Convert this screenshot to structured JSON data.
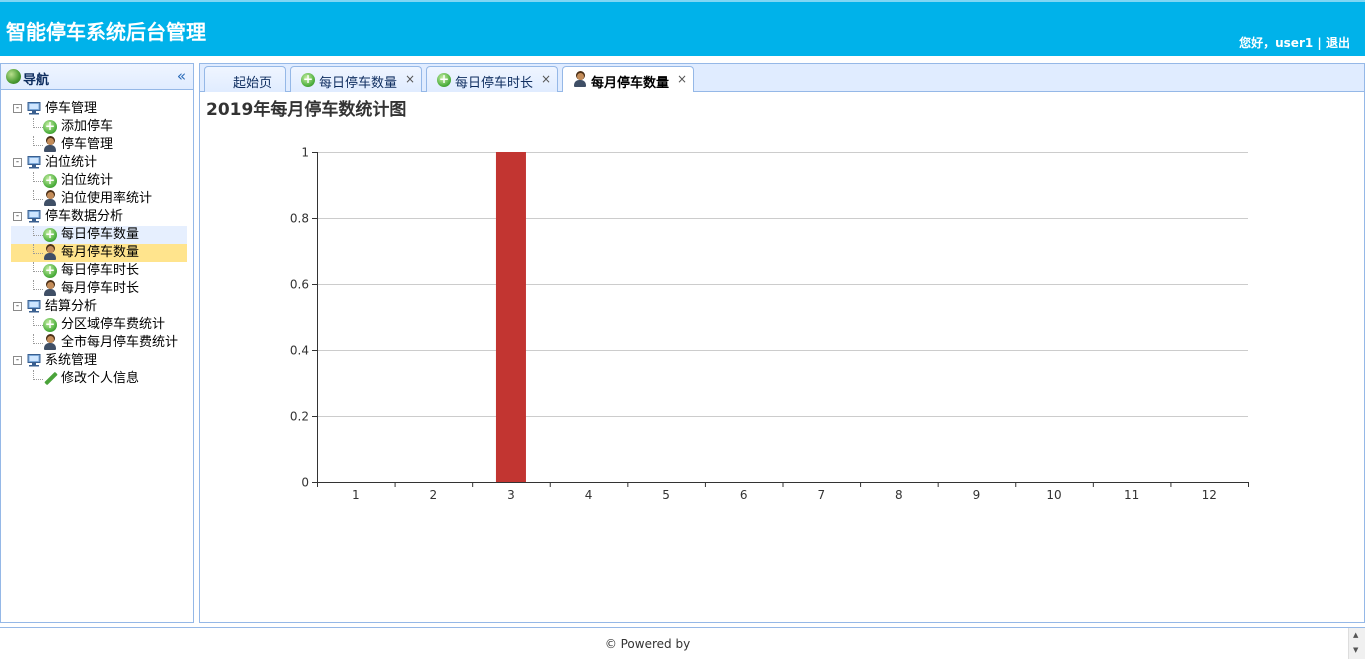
{
  "app": {
    "title": "智能停车系统后台管理",
    "greeting": "您好，user1",
    "separator": "|",
    "logout": "退出"
  },
  "nav": {
    "title": "导航",
    "collapse_icon": "double-chevron-left-icon",
    "groups": [
      {
        "label": "停车管理",
        "expander": "-",
        "items": [
          {
            "label": "添加停车",
            "icon": "add-icon"
          },
          {
            "label": "停车管理",
            "icon": "user-icon"
          }
        ]
      },
      {
        "label": "泊位统计",
        "expander": "-",
        "items": [
          {
            "label": "泊位统计",
            "icon": "add-icon"
          },
          {
            "label": "泊位使用率统计",
            "icon": "user-icon"
          }
        ]
      },
      {
        "label": "停车数据分析",
        "expander": "-",
        "items": [
          {
            "label": "每日停车数量",
            "icon": "add-icon"
          },
          {
            "label": "每月停车数量",
            "icon": "user-icon"
          },
          {
            "label": "每日停车时长",
            "icon": "add-icon"
          },
          {
            "label": "每月停车时长",
            "icon": "user-icon"
          }
        ]
      },
      {
        "label": "结算分析",
        "expander": "-",
        "items": [
          {
            "label": "分区域停车费统计",
            "icon": "add-icon"
          },
          {
            "label": "全市每月停车费统计",
            "icon": "user-icon"
          }
        ]
      },
      {
        "label": "系统管理",
        "expander": "-",
        "items": [
          {
            "label": "修改个人信息",
            "icon": "pencil-icon"
          }
        ]
      }
    ]
  },
  "tabs": [
    {
      "label": "起始页",
      "icon": "",
      "closable": false,
      "active": false
    },
    {
      "label": "每日停车数量",
      "icon": "add-icon",
      "close": "×",
      "active": false
    },
    {
      "label": "每日停车时长",
      "icon": "add-icon",
      "close": "×",
      "active": false
    },
    {
      "label": "每月停车数量",
      "icon": "user-icon",
      "close": "×",
      "active": true
    }
  ],
  "chart_data": {
    "type": "bar",
    "title": "2019年每月停车数统计图",
    "categories": [
      "1",
      "2",
      "3",
      "4",
      "5",
      "6",
      "7",
      "8",
      "9",
      "10",
      "11",
      "12"
    ],
    "values": [
      0,
      0,
      1,
      0,
      0,
      0,
      0,
      0,
      0,
      0,
      0,
      0
    ],
    "yticks": [
      "0",
      "0.2",
      "0.4",
      "0.6",
      "0.8",
      "1"
    ],
    "ylim": [
      0,
      1
    ],
    "grid": true,
    "bar_color": "#c23531",
    "xlabel": "",
    "ylabel": ""
  },
  "footer": {
    "text": "© Powered by"
  },
  "colors": {
    "header": "#00b2ea",
    "selected": "#ffe48d",
    "border": "#95b8e7"
  }
}
